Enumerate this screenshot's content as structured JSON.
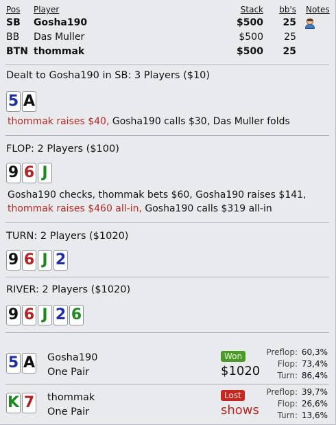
{
  "header": {
    "pos": "Pos",
    "player": "Player",
    "stack": "Stack",
    "bbs": "bb's",
    "notes": "Notes"
  },
  "players": [
    {
      "pos": "SB",
      "name": "Gosha190",
      "stack": "$500",
      "bbs": "25",
      "bold": true,
      "has_note": true
    },
    {
      "pos": "BB",
      "name": "Das Muller",
      "stack": "$500",
      "bbs": "25",
      "bold": false,
      "has_note": false
    },
    {
      "pos": "BTN",
      "name": "thommak",
      "stack": "$500",
      "bbs": "25",
      "bold": true,
      "has_note": false
    }
  ],
  "preflop": {
    "title": "Dealt to Gosha190 in SB: 3 Players ($10)",
    "cards": [
      {
        "rank": "5",
        "suit": "diamond"
      },
      {
        "rank": "A",
        "suit": "spade"
      }
    ],
    "action_red": "thommak raises $40,",
    "action_rest": " Gosha190 calls $30, Das Muller folds"
  },
  "flop": {
    "title": "FLOP: 2 Players ($100)",
    "cards": [
      {
        "rank": "9",
        "suit": "spade"
      },
      {
        "rank": "6",
        "suit": "heart"
      },
      {
        "rank": "J",
        "suit": "club"
      }
    ],
    "action_line1": "Gosha190 checks, thommak bets $60, Gosha190 raises $141,",
    "action_red": "thommak raises $460 all-in,",
    "action_rest": " Gosha190 calls $319 all-in"
  },
  "turn": {
    "title": "TURN: 2 Players ($1020)",
    "cards": [
      {
        "rank": "9",
        "suit": "spade"
      },
      {
        "rank": "6",
        "suit": "heart"
      },
      {
        "rank": "J",
        "suit": "club"
      },
      {
        "rank": "2",
        "suit": "diamond"
      }
    ]
  },
  "river": {
    "title": "RIVER: 2 Players ($1020)",
    "cards": [
      {
        "rank": "9",
        "suit": "spade"
      },
      {
        "rank": "6",
        "suit": "heart"
      },
      {
        "rank": "J",
        "suit": "club"
      },
      {
        "rank": "2",
        "suit": "diamond"
      },
      {
        "rank": "6",
        "suit": "club"
      }
    ]
  },
  "results": [
    {
      "name": "Gosha190",
      "hand": "One Pair",
      "cards": [
        {
          "rank": "5",
          "suit": "diamond"
        },
        {
          "rank": "A",
          "suit": "spade"
        }
      ],
      "badge": "Won",
      "badge_type": "won",
      "amount": "$1020",
      "equity": [
        {
          "street": "Preflop:",
          "value": "60,3%"
        },
        {
          "street": "Flop:",
          "value": "73,4%"
        },
        {
          "street": "Turn:",
          "value": "86,4%"
        }
      ]
    },
    {
      "name": "thommak",
      "hand": "One Pair",
      "cards": [
        {
          "rank": "K",
          "suit": "club"
        },
        {
          "rank": "7",
          "suit": "heart"
        }
      ],
      "badge": "Lost",
      "badge_type": "lost",
      "amount": "shows",
      "equity": [
        {
          "street": "Preflop:",
          "value": "39,7%"
        },
        {
          "street": "Flop:",
          "value": "26,6%"
        },
        {
          "street": "Turn:",
          "value": "13,6%"
        }
      ]
    }
  ],
  "colors": {
    "background": "#e8eaee",
    "action_red": "#b22a22",
    "won_badge": "#4a9a28",
    "lost_badge": "#c6281e"
  }
}
